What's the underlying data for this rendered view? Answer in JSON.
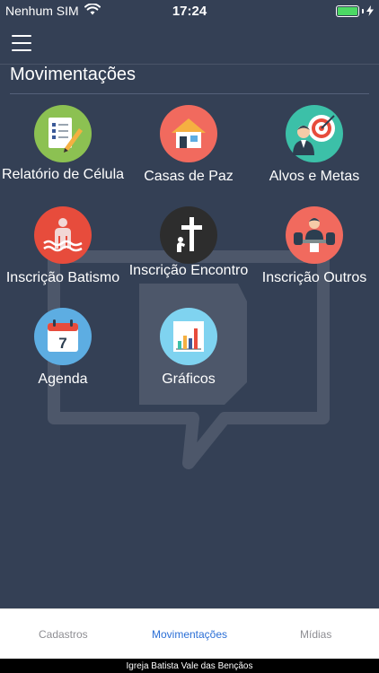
{
  "status_bar": {
    "carrier": "Nenhum SIM",
    "time": "17:24",
    "wifi_icon": "wifi-icon",
    "battery_icon": "battery-icon"
  },
  "nav": {
    "menu_icon": "hamburger-menu-icon"
  },
  "page": {
    "title": "Movimentações"
  },
  "items": [
    {
      "label": "Relatório de Célula",
      "icon": "report-checklist-icon",
      "color": "#8cc152"
    },
    {
      "label": "Casas de Paz",
      "icon": "house-icon",
      "color": "#f16a5e"
    },
    {
      "label": "Alvos e Metas",
      "icon": "target-businessman-icon",
      "color": "#3cc0a8"
    },
    {
      "label": "Inscrição Batismo",
      "icon": "baptism-person-icon",
      "color": "#e74c3c"
    },
    {
      "label": "Inscrição Encontro",
      "icon": "cross-prayer-icon",
      "color": "#2d2d2d"
    },
    {
      "label": "Inscrição Outros",
      "icon": "meeting-person-icon",
      "color": "#f16a5e"
    },
    {
      "label": "Agenda",
      "icon": "calendar-icon",
      "color": "#5dade2"
    },
    {
      "label": "Gráficos",
      "icon": "bar-chart-icon",
      "color": "#7fd3f0"
    }
  ],
  "calendar_day": "7",
  "tabs": [
    {
      "label": "Cadastros",
      "active": false
    },
    {
      "label": "Movimentações",
      "active": true
    },
    {
      "label": "Mídias",
      "active": false
    }
  ],
  "footer": {
    "text": "Igreja Batista Vale das Bençãos"
  }
}
